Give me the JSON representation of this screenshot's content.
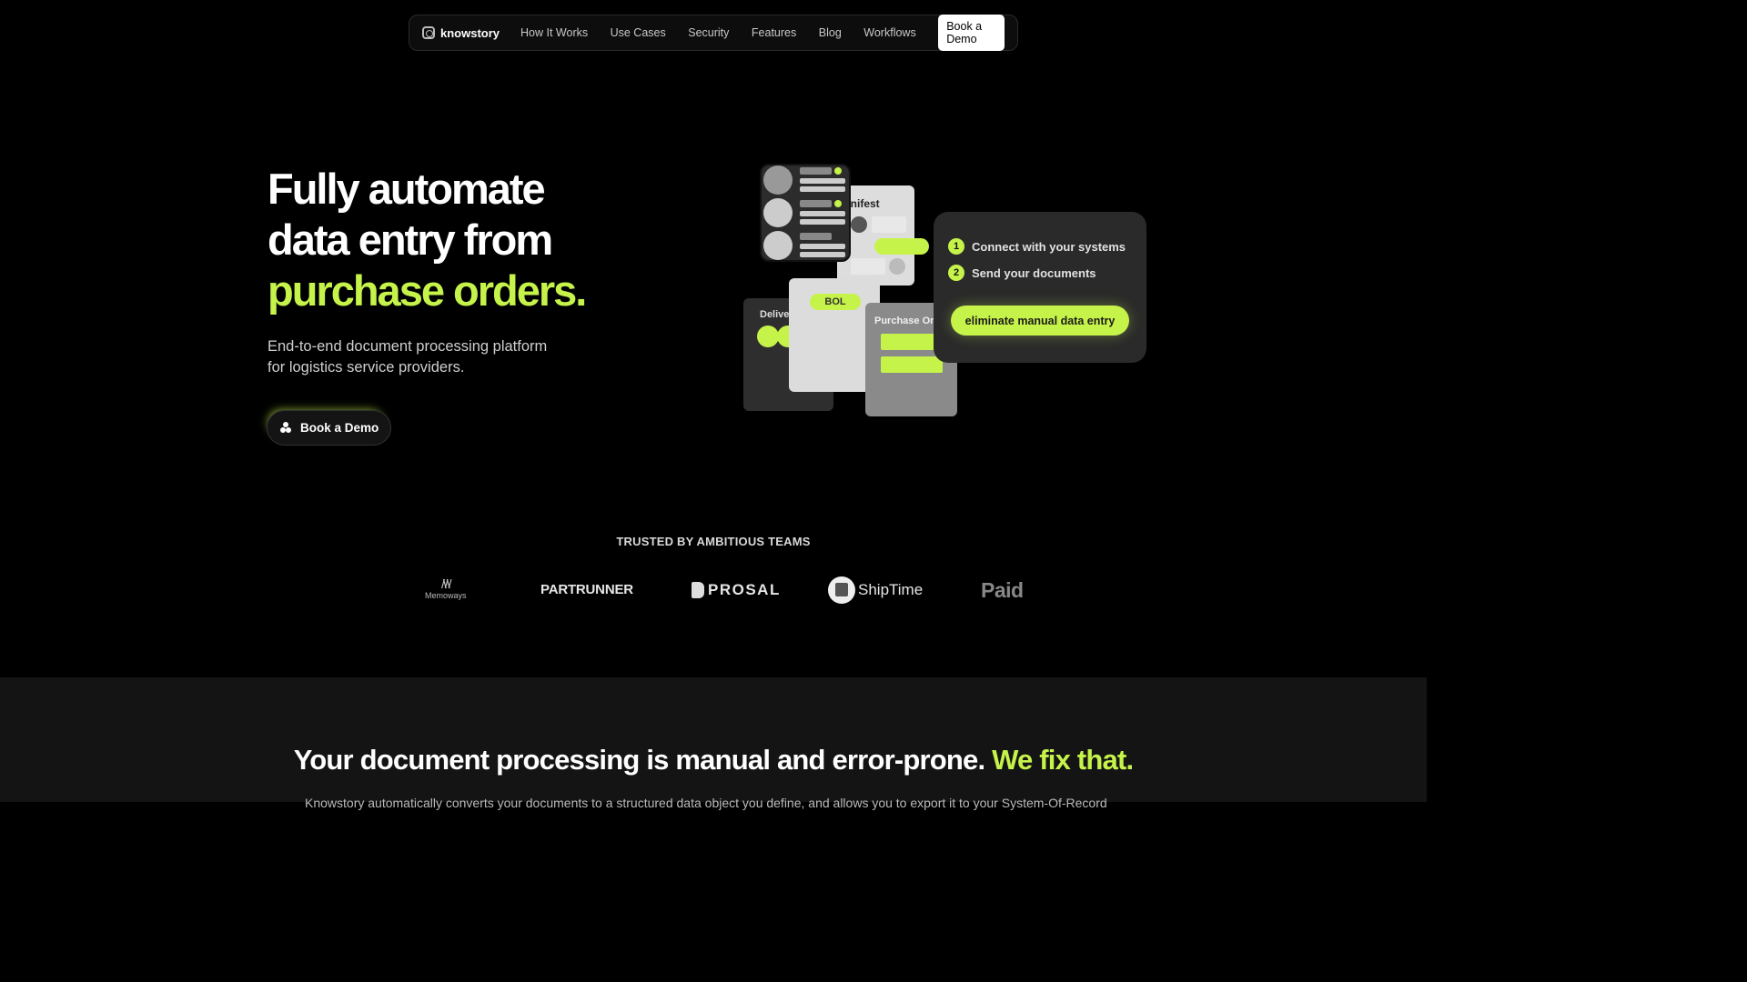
{
  "nav": {
    "brand": "knowstory",
    "links": [
      "How It Works",
      "Use Cases",
      "Security",
      "Features",
      "Blog",
      "Workflows"
    ],
    "cta": "Book a Demo"
  },
  "hero": {
    "title_line1": "Fully automate",
    "title_line2": "data entry from",
    "title_accent": "purchase orders.",
    "subtitle_line1": "End-to-end document processing platform",
    "subtitle_line2": "for logistics service providers.",
    "cta": "Book a Demo"
  },
  "illustration": {
    "cards": {
      "delivery": "Delive",
      "manifest": "anifest",
      "bol": "BOL",
      "purchase_order": "Purchase Or"
    },
    "steps": [
      {
        "num": "1",
        "label": "Connect with your systems"
      },
      {
        "num": "2",
        "label": "Send your documents"
      }
    ],
    "cta": "eliminate manual data entry"
  },
  "trusted": {
    "heading": "TRUSTED BY AMBITIOUS TEAMS",
    "logos": [
      "Memoways",
      "PARTRUNNER",
      "PROSAL",
      "ShipTime",
      "Paid"
    ]
  },
  "section2": {
    "title": "Your document processing is manual and error-prone.",
    "title_accent": "We fix that.",
    "text": "Knowstory automatically converts your documents to a structured data object you define, and allows you to export it to your System-Of-Record"
  },
  "colors": {
    "accent": "#c6f34a",
    "background": "#000000",
    "section_bg": "#141414"
  }
}
